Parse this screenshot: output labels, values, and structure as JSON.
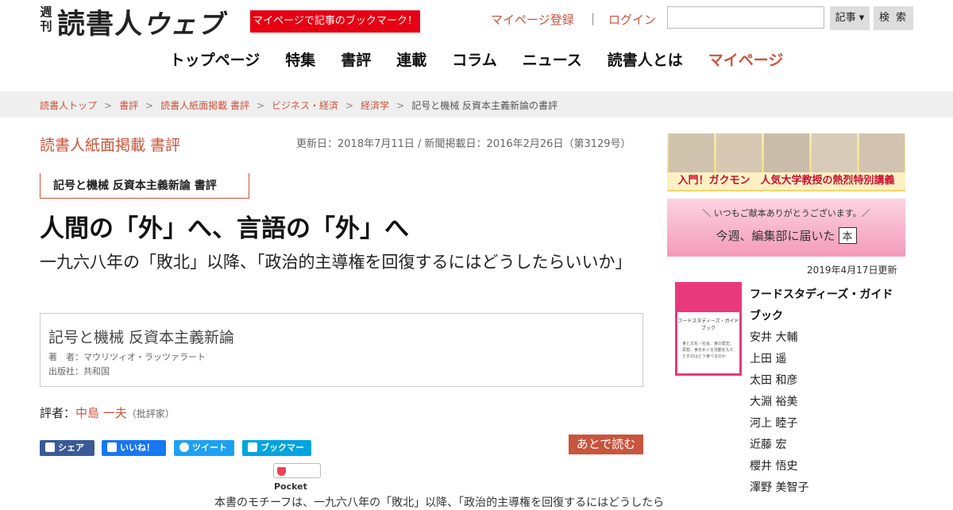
{
  "header": {
    "logo_sub": "週刊",
    "logo_main": "読書人",
    "logo_web": "ウェブ",
    "promo": "マイページで記事のブックマーク！",
    "register": "マイページ登録",
    "separator": "|",
    "login": "ログイン",
    "search_value": "",
    "search_scope": "記事 ▾",
    "search_button": "検 索"
  },
  "nav": {
    "items": [
      "トップページ",
      "特集",
      "書評",
      "連載",
      "コラム",
      "ニュース",
      "読書人とは",
      "マイページ"
    ]
  },
  "breadcrumb": {
    "items": [
      "読書人トップ",
      "書評",
      "読書人紙面掲載 書評",
      "ビジネス・経済",
      "経済学"
    ],
    "current": "記号と機械 反資本主義新論の書評",
    "sep": ">"
  },
  "article": {
    "section": "読書人紙面掲載 書評",
    "dates": "更新日：2018年7月11日 / 新聞掲載日：2016年2月26日（第3129号）",
    "book_tag": "記号と機械 反資本主義新論 書評",
    "headline": "人間の「外」へ、言語の「外」へ",
    "subhead": "一九六八年の「敗北」以降、「政治的主導権を回復するにはどうしたらいいか」",
    "book": {
      "title": "記号と機械 反資本主義新論",
      "author": "著　者：マウリツィオ・ラッツァラート",
      "publisher": "出版社：共和国"
    },
    "reviewer_label": "評者：",
    "reviewer_name": "中島 一夫",
    "reviewer_role": "（批評家）",
    "share": {
      "fb": "シェア",
      "like": "いいね！",
      "tw": "ツイート",
      "hb": "ブックマーク",
      "pocket": "Pocket"
    },
    "read_later": "あとで読む",
    "body_start": "本書のモチーフは、一九六八年の「敗北」以降、「政治的主導権を回復するにはどうしたら"
  },
  "sidebar": {
    "banner1_text": "入門！ガクモン　人気大学教授の熱烈特別講義",
    "banner2_top": "＼ いつもご献本ありがとうございます。／",
    "banner2_main": "今週、編集部に届いた",
    "banner2_box": "本",
    "updated": "2019年4月17日更新",
    "book_title": "フードスタディーズ・ガイドブック",
    "cover_title": "フードスタディーズ・ガイドブック",
    "cover_lines": "食と文化・社会、食の歴史、思想、食をめぐる活動をもたらすのはどう食べるのか",
    "names": [
      "安井 大輔",
      "上田 遥",
      "太田 和彦",
      "大淵 裕美",
      "河上 睦子",
      "近藤 宏",
      "櫻井 悟史",
      "澤野 美智子"
    ]
  },
  "colors": {
    "accent": "#c8553d",
    "promo_red": "#e60012"
  }
}
